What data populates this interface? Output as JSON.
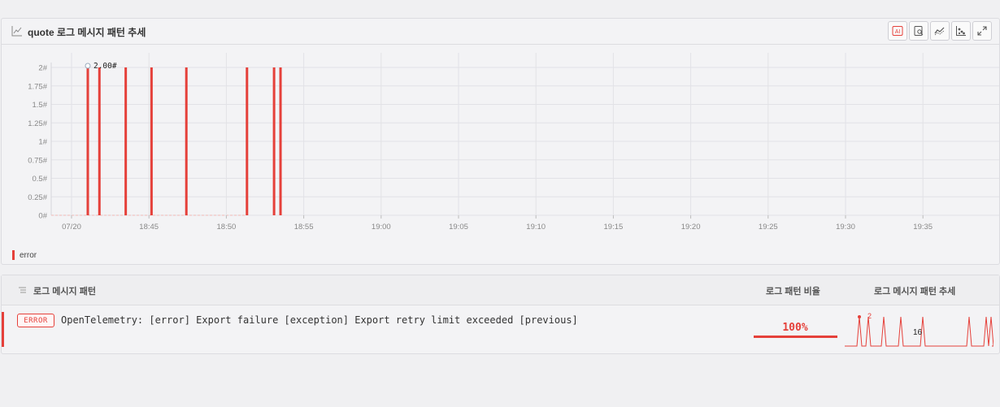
{
  "panel": {
    "title": "quote 로그 메시지 패턴 추세",
    "toolbar": [
      {
        "name": "ai-button",
        "label": "AI"
      },
      {
        "name": "search-log-icon",
        "label": ""
      },
      {
        "name": "trend-icon",
        "label": ""
      },
      {
        "name": "scatter-icon",
        "label": ""
      },
      {
        "name": "expand-icon",
        "label": ""
      }
    ]
  },
  "chart_data": {
    "type": "bar",
    "x_tick_labels": [
      "07/20",
      "18:45",
      "18:50",
      "18:55",
      "19:00",
      "19:05",
      "19:10",
      "19:15",
      "19:20",
      "19:25",
      "19:30",
      "19:35"
    ],
    "y_tick_labels": [
      "0#",
      "0.25#",
      "0.5#",
      "0.75#",
      "1#",
      "1.25#",
      "1.5#",
      "1.75#",
      "2#"
    ],
    "ylim": [
      0,
      2
    ],
    "series": [
      {
        "name": "error",
        "color": "#e5403a",
        "x": [
          "18:41:23",
          "18:42:08",
          "18:43:50",
          "18:45:30",
          "18:47:45",
          "18:51:40",
          "18:53:25",
          "18:53:50"
        ],
        "values": [
          2,
          2,
          2,
          2,
          2,
          2,
          2,
          2
        ]
      }
    ],
    "hover_label": "2.00#",
    "grid": true
  },
  "legend": {
    "label": "error"
  },
  "table": {
    "headers": {
      "pattern": "로그 메시지 패턴",
      "ratio": "로그 패턴 비율",
      "trend": "로그 메시지 패턴 추세"
    },
    "rows": [
      {
        "level": "ERROR",
        "message": "OpenTelemetry: [error] Export failure [exception] Export retry limit exceeded [previous]",
        "ratio_text": "100%",
        "ratio": 1.0,
        "spark_max_label": "2",
        "spark_count": "16"
      }
    ]
  }
}
